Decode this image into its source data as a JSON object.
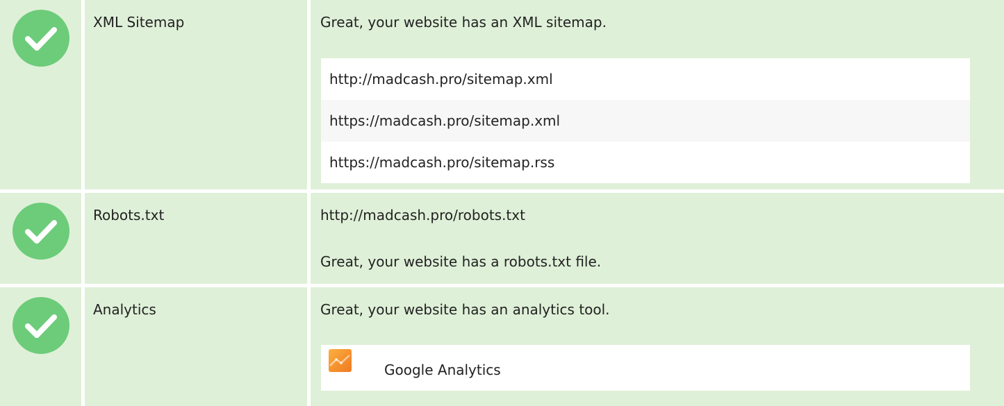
{
  "theme": {
    "pass_background": "#dff0d8",
    "check_color": "#6ccc7a",
    "text_color": "#222222"
  },
  "checks": {
    "sitemap": {
      "status_icon": "check-circle-icon",
      "name": "XML Sitemap",
      "message": "Great, your website has an XML sitemap.",
      "urls": [
        "http://madcash.pro/sitemap.xml",
        "https://madcash.pro/sitemap.xml",
        "https://madcash.pro/sitemap.rss"
      ]
    },
    "robots": {
      "status_icon": "check-circle-icon",
      "name": "Robots.txt",
      "url": "http://madcash.pro/robots.txt",
      "message": "Great, your website has a robots.txt file."
    },
    "analytics": {
      "status_icon": "check-circle-icon",
      "name": "Analytics",
      "message": "Great, your website has an analytics tool.",
      "tools": [
        {
          "icon": "google-analytics-icon",
          "name": "Google Analytics"
        }
      ]
    }
  }
}
